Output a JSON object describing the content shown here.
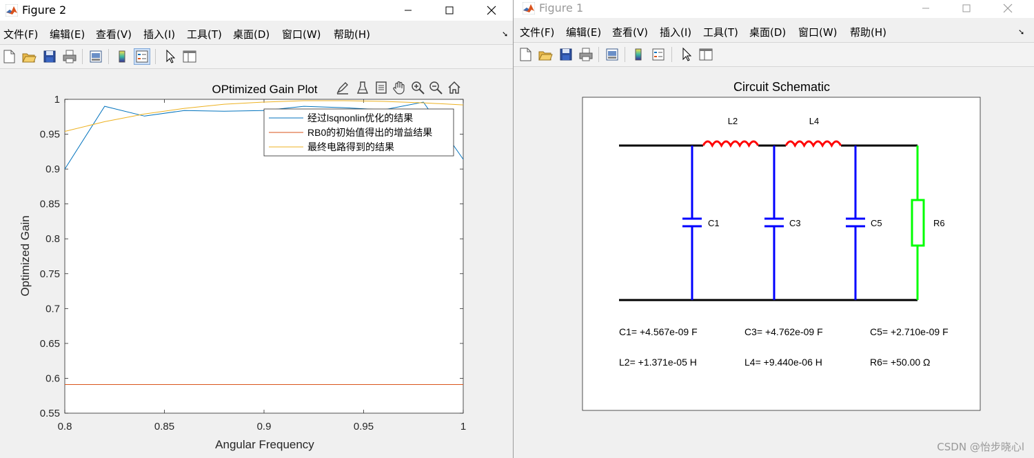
{
  "figure2": {
    "window_title": "Figure 2",
    "menu": [
      "文件(F)",
      "编辑(E)",
      "查看(V)",
      "插入(I)",
      "工具(T)",
      "桌面(D)",
      "窗口(W)",
      "帮助(H)"
    ],
    "toolbar_icons": [
      "new-figure-icon",
      "open-icon",
      "save-icon",
      "print-icon",
      "print-preview-icon",
      "colorbar-icon",
      "legend-icon",
      "pointer-icon",
      "property-inspector-icon"
    ],
    "axes_toolbar_icons": [
      "brush-icon",
      "data-tips-icon",
      "rotate-icon",
      "pan-icon",
      "zoom-in-icon",
      "zoom-out-icon",
      "home-icon"
    ]
  },
  "figure1": {
    "window_title": "Figure 1",
    "menu": [
      "文件(F)",
      "编辑(E)",
      "查看(V)",
      "插入(I)",
      "工具(T)",
      "桌面(D)",
      "窗口(W)",
      "帮助(H)"
    ],
    "schematic": {
      "title": "Circuit Schematic",
      "component_labels": [
        "L2",
        "L4",
        "C1",
        "C3",
        "C5",
        "R6"
      ],
      "values": [
        "C1= +4.567e-09 F",
        "C3= +4.762e-09 F",
        "C5= +2.710e-09 F",
        "L2= +1.371e-05 H",
        "L4= +9.440e-06 H",
        "R6= +50.00 Ω"
      ],
      "colors": {
        "wire": "#000000",
        "capacitor": "#0000ff",
        "inductor": "#ff0000",
        "resistor": "#00ff00"
      }
    }
  },
  "chart_data": {
    "type": "line",
    "title": "OPtimized Gain Plot",
    "xlabel": "Angular Frequency",
    "ylabel": "Optimized Gain",
    "xlim": [
      0.8,
      1
    ],
    "ylim": [
      0.55,
      1
    ],
    "xticks": [
      "0.8",
      "0.85",
      "0.9",
      "0.95",
      "1"
    ],
    "yticks": [
      "0.55",
      "0.6",
      "0.65",
      "0.7",
      "0.75",
      "0.8",
      "0.85",
      "0.9",
      "0.95",
      "1"
    ],
    "legend_position": "top-right",
    "grid": false,
    "series": [
      {
        "name": "经过lsqnonlin优化的结果",
        "color": "#0072bd",
        "x": [
          0.8,
          0.82,
          0.84,
          0.86,
          0.88,
          0.9,
          0.92,
          0.94,
          0.96,
          0.98,
          1.0
        ],
        "y": [
          0.9,
          0.99,
          0.976,
          0.984,
          0.983,
          0.984,
          0.99,
          0.988,
          0.985,
          0.996,
          0.914
        ]
      },
      {
        "name": "RB0的初始值得出的增益结果",
        "color": "#d95319",
        "x": [
          0.8,
          1.0
        ],
        "y": [
          0.591,
          0.591
        ]
      },
      {
        "name": "最终电路得到的结果",
        "color": "#edb120",
        "x": [
          0.8,
          0.82,
          0.84,
          0.86,
          0.88,
          0.9,
          0.92,
          0.94,
          0.96,
          0.98,
          1.0
        ],
        "y": [
          0.954,
          0.968,
          0.979,
          0.987,
          0.993,
          0.996,
          0.998,
          0.998,
          0.997,
          0.995,
          0.992
        ]
      }
    ]
  },
  "watermark": "CSDN @怡步晓心l"
}
